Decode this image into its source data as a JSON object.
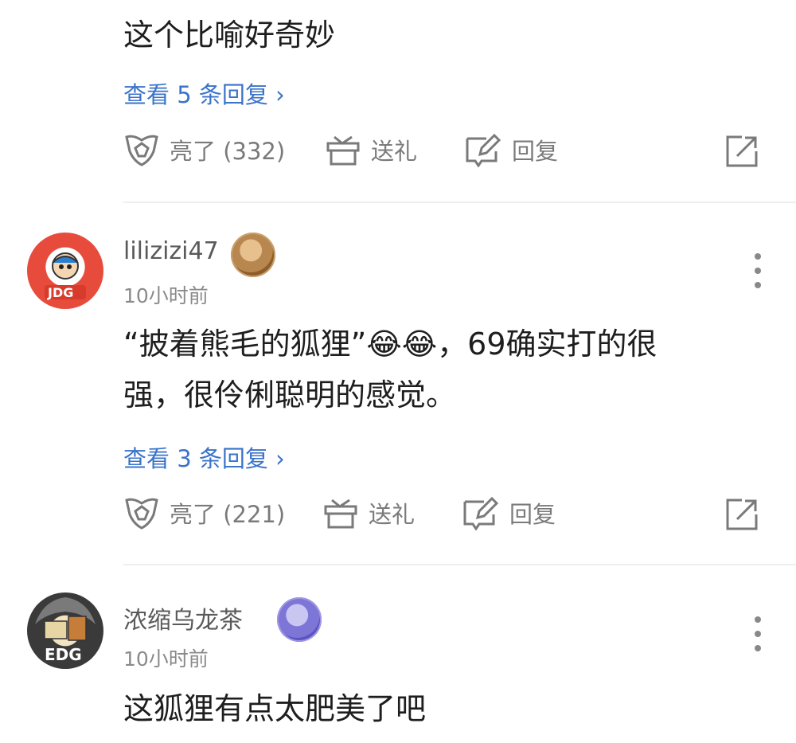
{
  "comment_top": {
    "text": "这个比喻好奇妙",
    "view_replies": "查看 5 条回复 ›",
    "actions": {
      "like": "亮了 (332)",
      "gift": "送礼",
      "reply": "回复"
    }
  },
  "comment_2": {
    "username": "lilizizi47",
    "time": "10小时前",
    "avatar_text": "JDG",
    "text_line1": "“披着熊毛的狐狸”😂😂，69确实打的很",
    "text_line2": "强，很伶俐聪明的感觉。",
    "view_replies": "查看 3 条回复 ›",
    "actions": {
      "like": "亮了 (221)",
      "gift": "送礼",
      "reply": "回复"
    }
  },
  "comment_3": {
    "username": "浓缩乌龙茶",
    "time": "10小时前",
    "avatar_text": "EDG",
    "text": "这狐狸有点太肥美了吧"
  },
  "colors": {
    "link": "#3a73c9",
    "icon": "#7a7a7a",
    "divider": "#efefef"
  }
}
